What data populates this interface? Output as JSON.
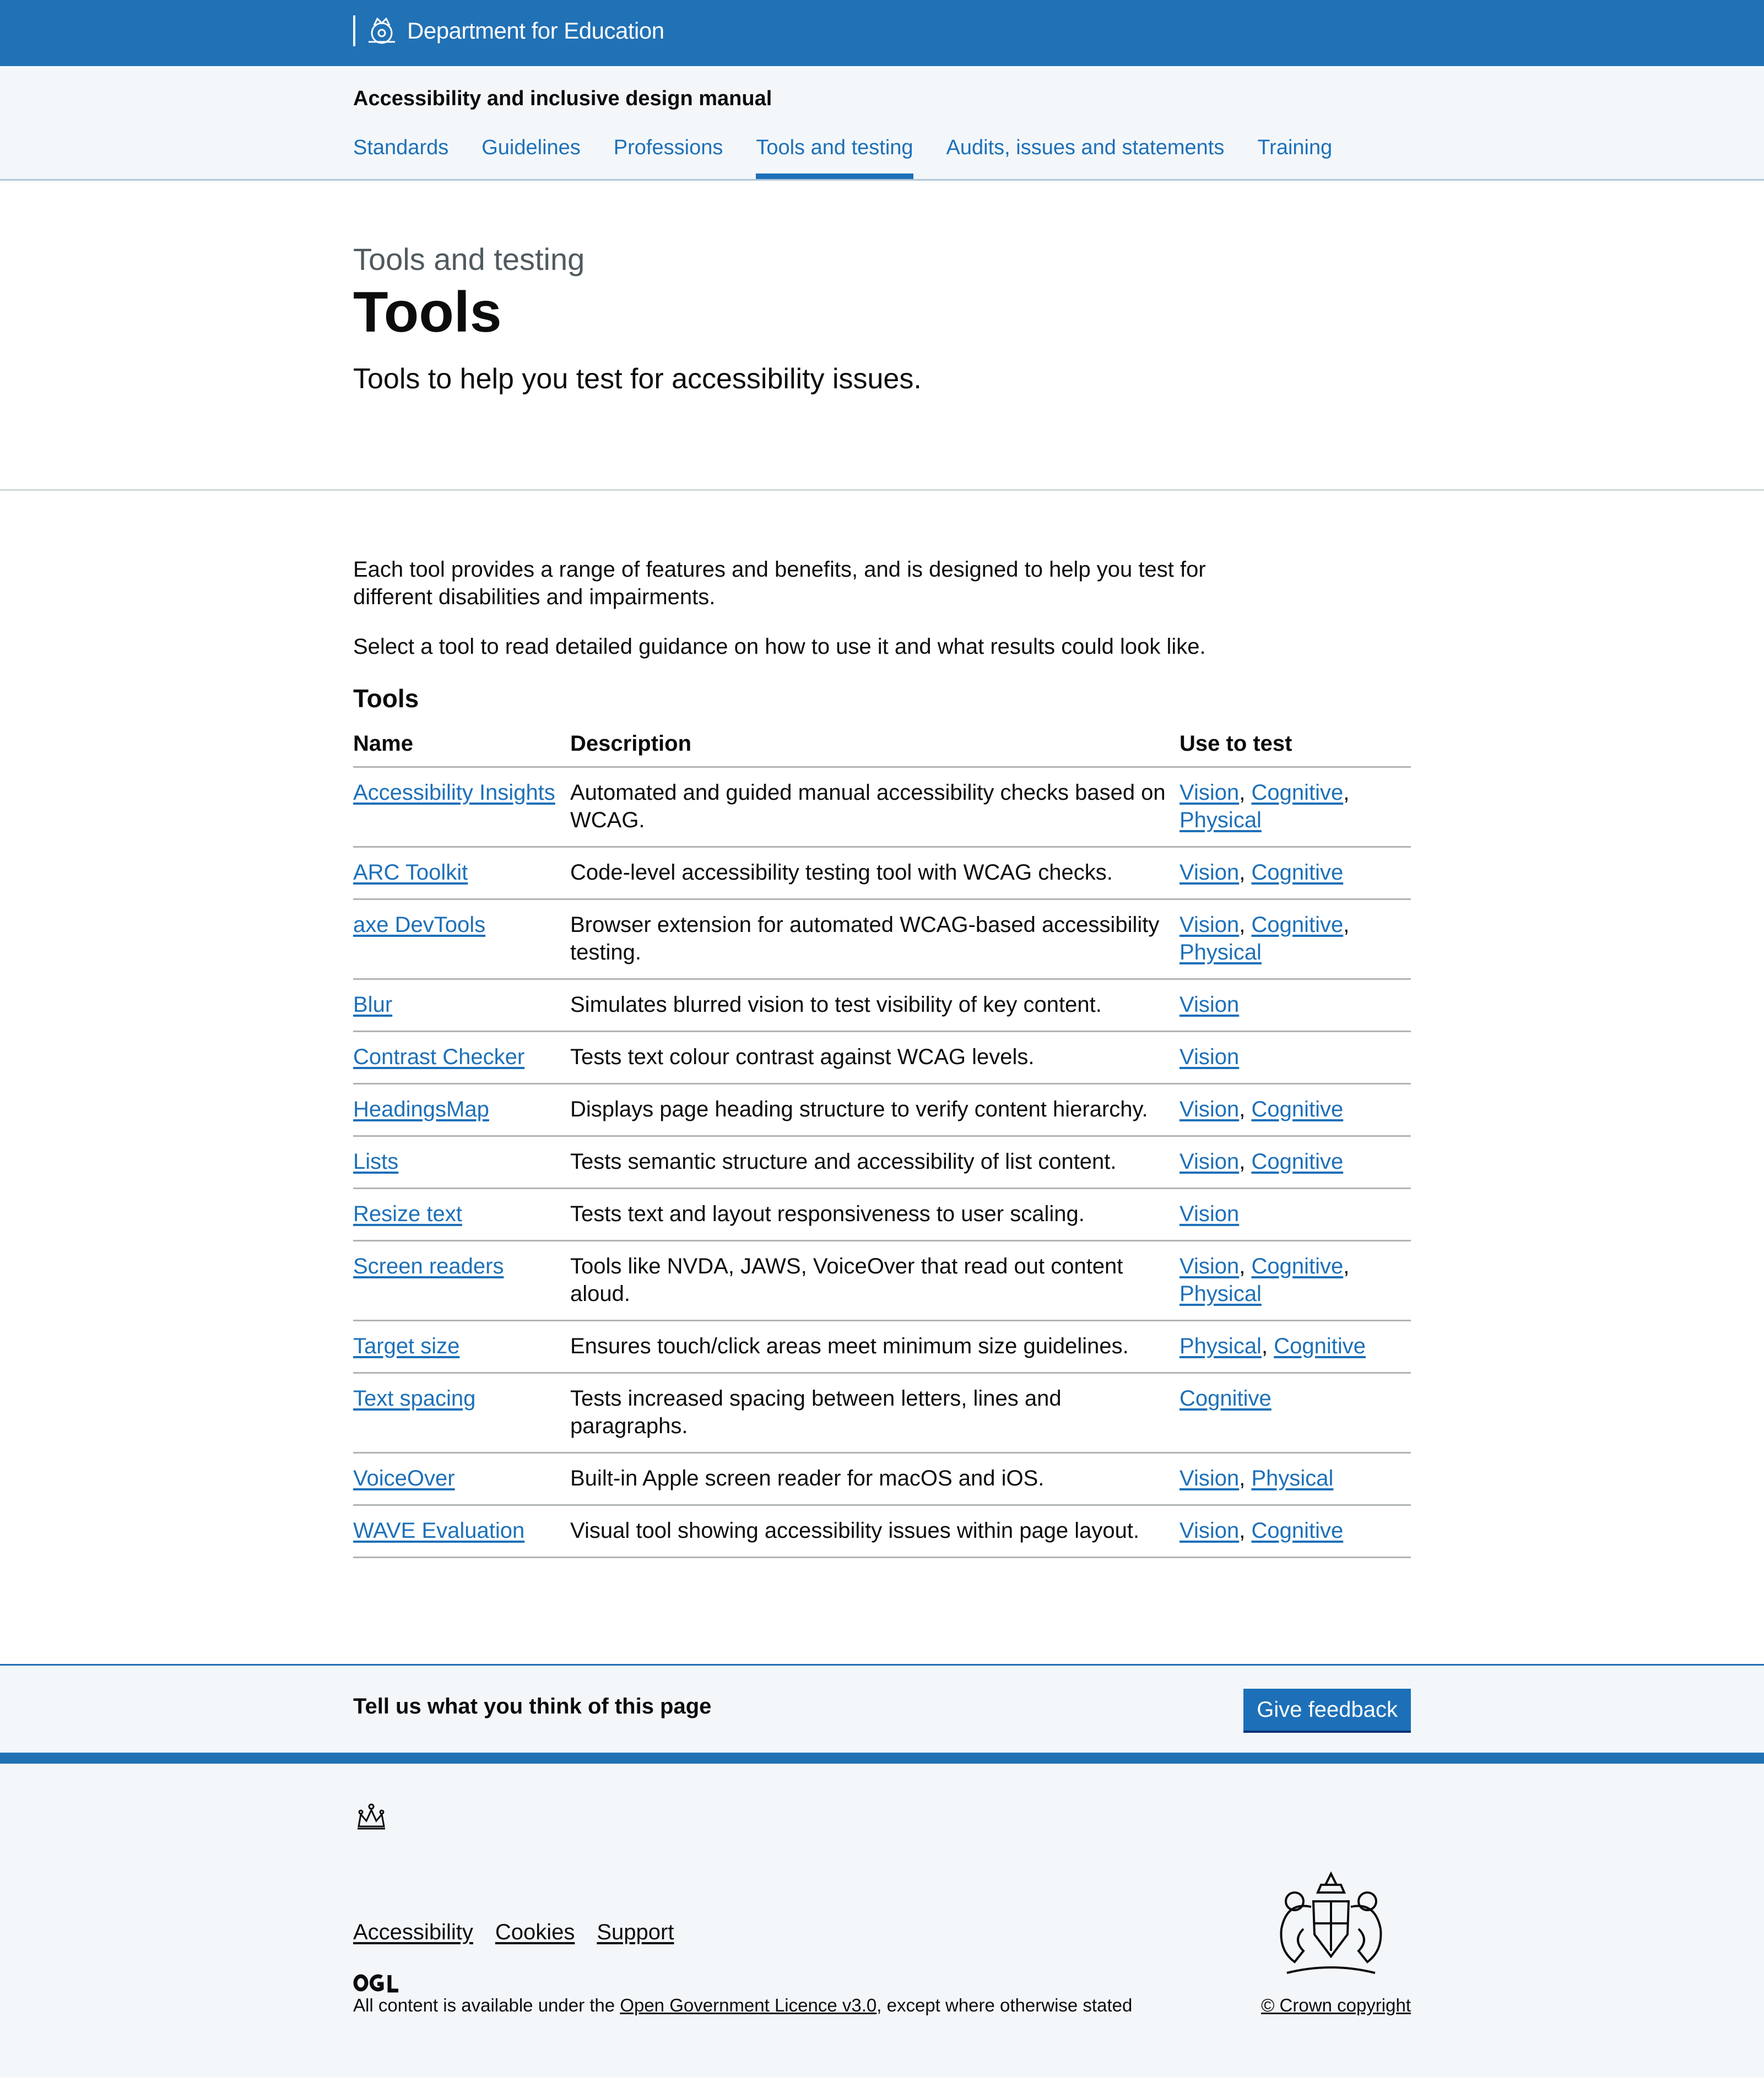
{
  "header": {
    "brand": "Department for Education"
  },
  "service": {
    "name": "Accessibility and inclusive design manual",
    "nav": [
      {
        "label": "Standards"
      },
      {
        "label": "Guidelines"
      },
      {
        "label": "Professions"
      },
      {
        "label": "Tools and testing",
        "active": true
      },
      {
        "label": "Audits, issues and statements"
      },
      {
        "label": "Training"
      }
    ]
  },
  "hero": {
    "caption": "Tools and testing",
    "title": "Tools",
    "lead": "Tools to help you test for accessibility issues."
  },
  "main": {
    "intro": "Each tool provides a range of features and benefits, and is designed to help you test for different disabilities and impairments.",
    "select": "Select a tool to read detailed guidance on how to use it and what results could look like.",
    "table_title": "Tools",
    "columns": [
      "Name",
      "Description",
      "Use to test"
    ],
    "rows": [
      {
        "name": "Accessibility Insights",
        "desc": "Automated and guided manual accessibility checks based on WCAG.",
        "uses": [
          "Vision",
          "Cognitive",
          "Physical"
        ]
      },
      {
        "name": "ARC Toolkit",
        "desc": "Code-level accessibility testing tool with WCAG checks.",
        "uses": [
          "Vision",
          "Cognitive"
        ]
      },
      {
        "name": "axe DevTools",
        "desc": "Browser extension for automated WCAG-based accessibility testing.",
        "uses": [
          "Vision",
          "Cognitive",
          "Physical"
        ]
      },
      {
        "name": "Blur",
        "desc": "Simulates blurred vision to test visibility of key content.",
        "uses": [
          "Vision"
        ]
      },
      {
        "name": "Contrast Checker",
        "desc": "Tests text colour contrast against WCAG levels.",
        "uses": [
          "Vision"
        ]
      },
      {
        "name": "HeadingsMap",
        "desc": "Displays page heading structure to verify content hierarchy.",
        "uses": [
          "Vision",
          "Cognitive"
        ]
      },
      {
        "name": "Lists",
        "desc": "Tests semantic structure and accessibility of list content.",
        "uses": [
          "Vision",
          "Cognitive"
        ]
      },
      {
        "name": "Resize text",
        "desc": "Tests text and layout responsiveness to user scaling.",
        "uses": [
          "Vision"
        ]
      },
      {
        "name": "Screen readers",
        "desc": "Tools like NVDA, JAWS, VoiceOver that read out content aloud.",
        "uses": [
          "Vision",
          "Cognitive",
          "Physical"
        ]
      },
      {
        "name": "Target size",
        "desc": "Ensures touch/click areas meet minimum size guidelines.",
        "uses": [
          "Physical",
          "Cognitive"
        ]
      },
      {
        "name": "Text spacing",
        "desc": "Tests increased spacing between letters, lines and paragraphs.",
        "uses": [
          "Cognitive"
        ]
      },
      {
        "name": "VoiceOver",
        "desc": "Built-in Apple screen reader for macOS and iOS.",
        "uses": [
          "Vision",
          "Physical"
        ]
      },
      {
        "name": "WAVE Evaluation",
        "desc": "Visual tool showing accessibility issues within page layout.",
        "uses": [
          "Vision",
          "Cognitive"
        ]
      }
    ]
  },
  "feedback": {
    "text": "Tell us what you think of this page",
    "button": "Give feedback"
  },
  "footer": {
    "links": [
      "Accessibility",
      "Cookies",
      "Support"
    ],
    "licence_prefix": "All content is available under the ",
    "licence_link": "Open Government Licence v3.0",
    "licence_suffix": ", except where otherwise stated",
    "copyright": "© Crown copyright"
  },
  "colors": {
    "brand_blue": "#2171b5",
    "link_blue": "#1d70b8",
    "text": "#0b0c0c",
    "panel_bg": "#f4f7fa"
  },
  "icons": {
    "header_logo": "crest-icon",
    "footer_logo": "crown-icon",
    "licence_logo": "ogl-icon",
    "coat_of_arms": "royal-coat-of-arms-icon"
  }
}
